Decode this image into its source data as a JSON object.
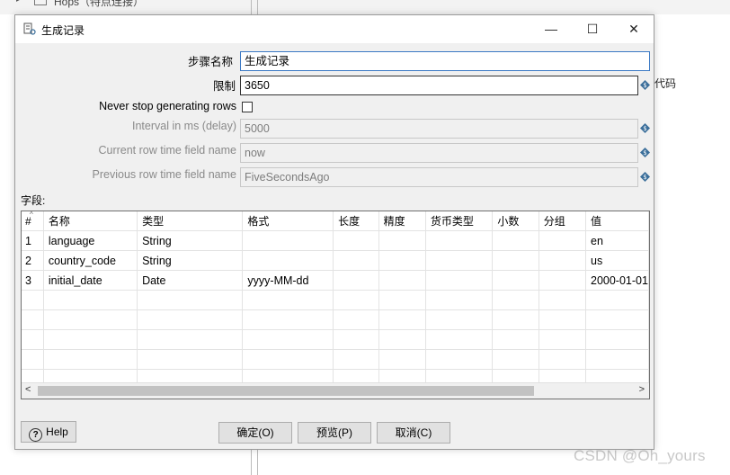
{
  "background": {
    "top_text": "Hops（特点连接）",
    "right_text": "代码"
  },
  "watermark": "CSDN @Oh_yours",
  "dialog": {
    "title": "生成记录",
    "window_controls": {
      "minimize": "—",
      "maximize": "☐",
      "close": "✕"
    },
    "fields": {
      "step_name": {
        "label": "步骤名称",
        "value": "生成记录"
      },
      "limit": {
        "label": "限制",
        "value": "3650"
      },
      "never_stop": {
        "label": "Never stop generating rows",
        "checked": false
      },
      "interval": {
        "label": "Interval in ms (delay)",
        "value": "5000"
      },
      "current_time_field": {
        "label": "Current row time field name",
        "value": "now"
      },
      "previous_time_field": {
        "label": "Previous row time field name",
        "value": "FiveSecondsAgo"
      }
    },
    "fields_section_label": "字段:",
    "table": {
      "columns": [
        "#",
        "名称",
        "类型",
        "格式",
        "长度",
        "精度",
        "货币类型",
        "小数",
        "分组",
        "值"
      ],
      "rows": [
        [
          "1",
          "language",
          "String",
          "",
          "",
          "",
          "",
          "",
          "",
          "en"
        ],
        [
          "2",
          "country_code",
          "String",
          "",
          "",
          "",
          "",
          "",
          "",
          "us"
        ],
        [
          "3",
          "initial_date",
          "Date",
          "yyyy-MM-dd",
          "",
          "",
          "",
          "",
          "",
          "2000-01-01"
        ]
      ],
      "scrollbar": {
        "left": "<",
        "right": ">"
      }
    },
    "buttons": {
      "help": "Help",
      "ok": "确定(O)",
      "preview": "预览(P)",
      "cancel": "取消(C)"
    },
    "icons": {
      "variable": "variable-diamond-icon",
      "title": "generate-rows-icon"
    },
    "colors": {
      "focus_border": "#3b79c4",
      "variable_icon": "#3a6e9a"
    }
  }
}
